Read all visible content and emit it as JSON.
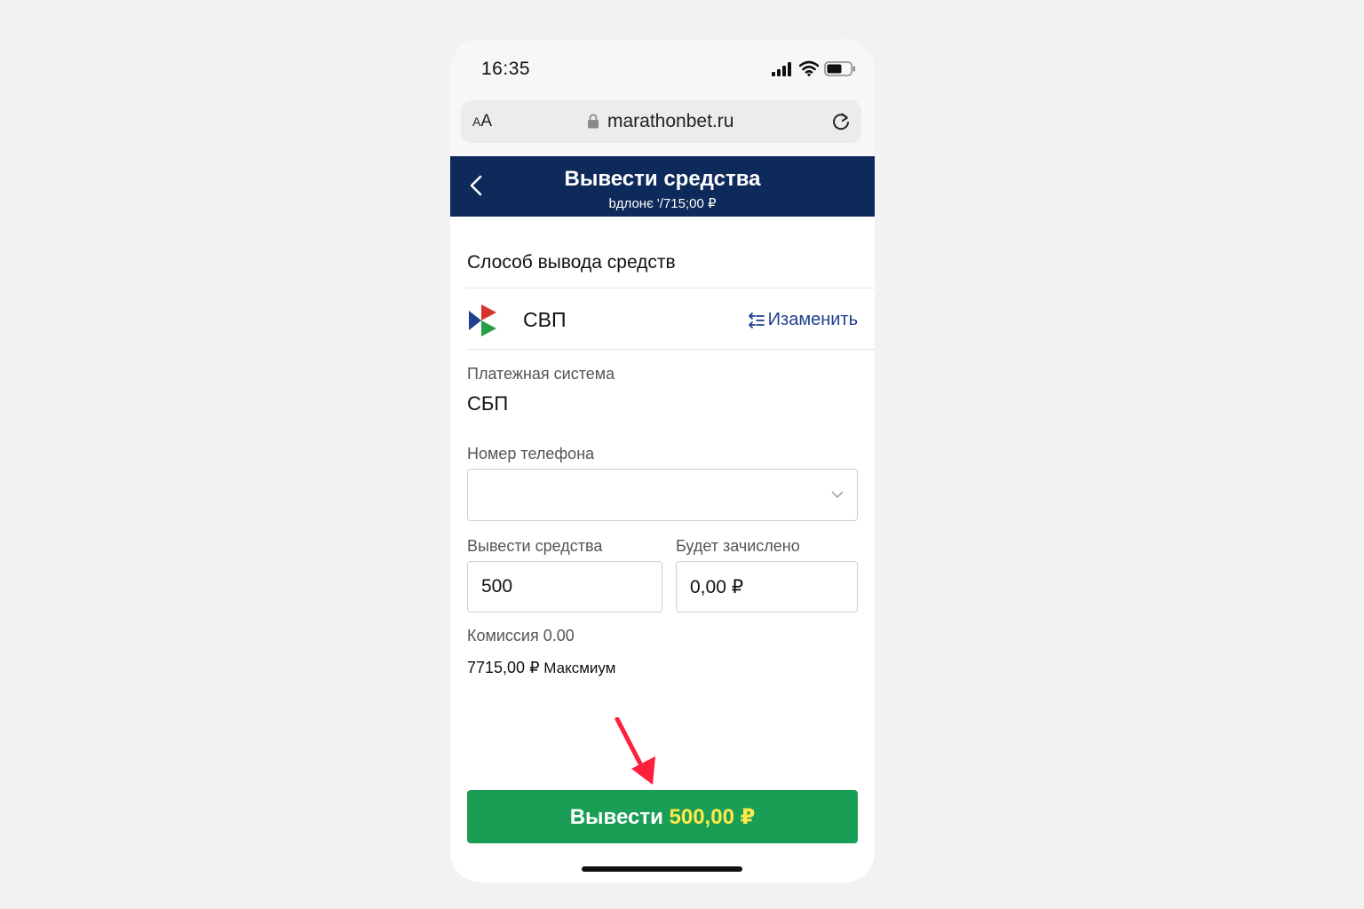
{
  "status_bar": {
    "time": "16:35"
  },
  "browser": {
    "text_size_small": "A",
    "text_size_large": "A",
    "url": "marathonbet.ru",
    "lock_icon": "lock-icon",
    "reload_icon": "reload-icon"
  },
  "header": {
    "title": "Вывести средства",
    "balance": "bдлонє '/715;00 ₽",
    "back_icon": "chevron-left-icon",
    "background_color": "#0e2a5a"
  },
  "method": {
    "section_title": "Слособ вывода средств",
    "name": "СВП",
    "change_label": "Изаменить",
    "logo_icon": "sbp-logo-icon"
  },
  "payment_system": {
    "label": "Платежная система",
    "value": "СБП"
  },
  "phone": {
    "label": "Номер телефона",
    "value": ""
  },
  "withdraw": {
    "label": "Вывести средства",
    "value": "500"
  },
  "credited": {
    "label": "Будет зачислено",
    "value": "0,00 ₽"
  },
  "commission": "Комиссия 0.00",
  "maximum": {
    "amount": "7715,00 ₽",
    "label": "Максмиум"
  },
  "submit": {
    "label": "Вывести",
    "amount": "500,00 ₽",
    "color": "#1a9e55",
    "amount_color": "#ffe94a"
  }
}
